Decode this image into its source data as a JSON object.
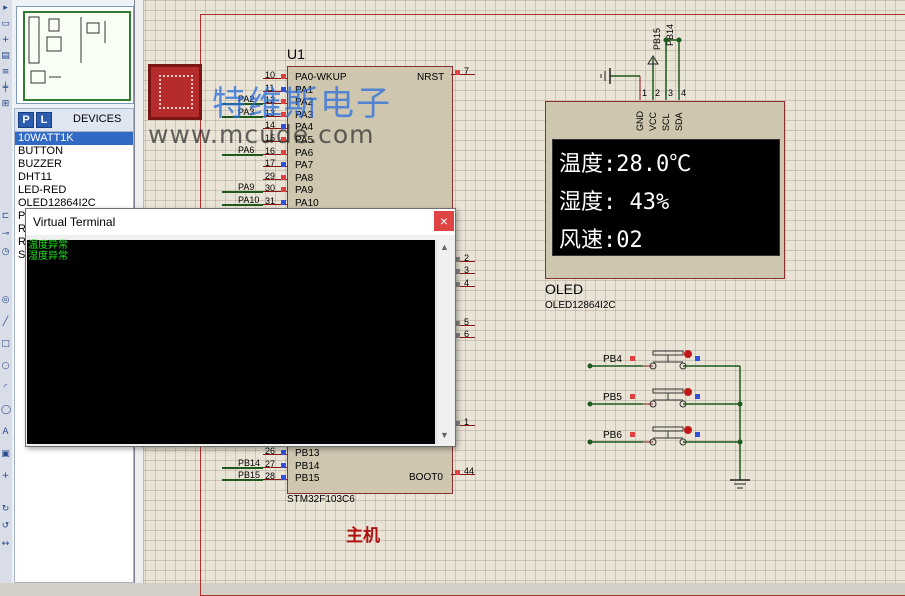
{
  "devices_panel": {
    "tab_p": "P",
    "tab_l": "L",
    "header_label": "DEVICES",
    "items": [
      "10WATT1K",
      "BUTTON",
      "BUZZER",
      "DHT11",
      "LED-RED",
      "OLED12864I2C",
      "P",
      "R",
      "R",
      "S"
    ],
    "selected_index": 0
  },
  "watermark": {
    "brand_cn": "特维斯电子",
    "url": "www.mcude.com"
  },
  "mcu": {
    "ref": "U1",
    "part": "STM32F103C6",
    "title": "主机",
    "left_pins": [
      {
        "num": "10",
        "name": "PA0-WKUP",
        "net": ""
      },
      {
        "num": "11",
        "name": "PA1",
        "net": ""
      },
      {
        "num": "12",
        "name": "PA2",
        "net": "PA2"
      },
      {
        "num": "13",
        "name": "PA3",
        "net": "PA3"
      },
      {
        "num": "14",
        "name": "PA4",
        "net": ""
      },
      {
        "num": "15",
        "name": "PA5",
        "net": ""
      },
      {
        "num": "16",
        "name": "PA6",
        "net": "PA6"
      },
      {
        "num": "17",
        "name": "PA7",
        "net": ""
      },
      {
        "num": "29",
        "name": "PA8",
        "net": ""
      },
      {
        "num": "30",
        "name": "PA9",
        "net": "PA9"
      },
      {
        "num": "31",
        "name": "PA10",
        "net": "PA10"
      }
    ],
    "bottom_left_pins": [
      {
        "num": "26",
        "name": "PB13",
        "net": ""
      },
      {
        "num": "27",
        "name": "PB14",
        "net": "PB14"
      },
      {
        "num": "28",
        "name": "PB15",
        "net": "PB15"
      }
    ],
    "right_pins": [
      {
        "num": "7",
        "name": "NRST"
      },
      {
        "num": "2",
        "name": ""
      },
      {
        "num": "3",
        "name": ""
      },
      {
        "num": "4",
        "name": ""
      },
      {
        "num": "5",
        "name": ""
      },
      {
        "num": "6",
        "name": ""
      },
      {
        "num": "1",
        "name": ""
      },
      {
        "num": "44",
        "name": "BOOT0"
      }
    ]
  },
  "oled": {
    "ref": "OLED",
    "part": "OLED12864I2C",
    "pins": [
      {
        "num": "1",
        "name": "GND"
      },
      {
        "num": "2",
        "name": "VCC"
      },
      {
        "num": "3",
        "name": "SCL"
      },
      {
        "num": "4",
        "name": "SDA"
      }
    ],
    "top_nets": [
      "PB15",
      "PB14"
    ],
    "lines": [
      "温度:28.0℃",
      "湿度: 43%",
      "风速:02"
    ]
  },
  "buttons": [
    {
      "net": "PB4"
    },
    {
      "net": "PB5"
    },
    {
      "net": "PB6"
    }
  ],
  "virtual_terminal": {
    "title": "Virtual Terminal",
    "close_glyph": "×",
    "lines": [
      "温度异常",
      "湿度异常"
    ]
  }
}
